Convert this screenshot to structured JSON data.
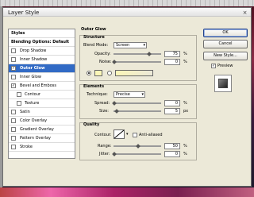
{
  "window": {
    "title": "Layer Style",
    "close_glyph": "×"
  },
  "sidebar": {
    "items": [
      {
        "label": "Styles",
        "checkbox": false,
        "checked": false
      },
      {
        "label": "Blending Options: Default",
        "checkbox": false,
        "checked": false
      },
      {
        "label": "Drop Shadow",
        "checkbox": true,
        "checked": false
      },
      {
        "label": "Inner Shadow",
        "checkbox": true,
        "checked": false
      },
      {
        "label": "Outer Glow",
        "checkbox": true,
        "checked": true,
        "selected": true
      },
      {
        "label": "Inner Glow",
        "checkbox": true,
        "checked": false
      },
      {
        "label": "Bevel and Emboss",
        "checkbox": true,
        "checked": true
      },
      {
        "label": "Contour",
        "checkbox": true,
        "checked": false,
        "indent": true
      },
      {
        "label": "Texture",
        "checkbox": true,
        "checked": false,
        "indent": true
      },
      {
        "label": "Satin",
        "checkbox": true,
        "checked": false
      },
      {
        "label": "Color Overlay",
        "checkbox": true,
        "checked": false
      },
      {
        "label": "Gradient Overlay",
        "checkbox": true,
        "checked": false
      },
      {
        "label": "Pattern Overlay",
        "checkbox": true,
        "checked": false
      },
      {
        "label": "Stroke",
        "checkbox": true,
        "checked": false
      }
    ]
  },
  "outer_glow": {
    "title": "Outer Glow",
    "structure": {
      "title": "Structure",
      "blend_mode_label": "Blend Mode:",
      "blend_mode_value": "Screen",
      "opacity_label": "Opacity:",
      "opacity_value": "75",
      "noise_label": "Noise:",
      "noise_value": "0",
      "percent": "%",
      "glow_color": "#fbf6b8"
    },
    "elements": {
      "title": "Elements",
      "technique_label": "Technique:",
      "technique_value": "Precise",
      "spread_label": "Spread:",
      "spread_value": "0",
      "size_label": "Size:",
      "size_value": "5",
      "percent": "%",
      "px": "px"
    },
    "quality": {
      "title": "Quality",
      "contour_label": "Contour:",
      "anti_aliased_label": "Anti-aliased",
      "range_label": "Range:",
      "range_value": "50",
      "jitter_label": "Jitter:",
      "jitter_value": "0",
      "percent": "%"
    }
  },
  "buttons": {
    "ok": "OK",
    "cancel": "Cancel",
    "new_style": "New Style...",
    "preview_label": "Preview",
    "preview_checked": true
  }
}
